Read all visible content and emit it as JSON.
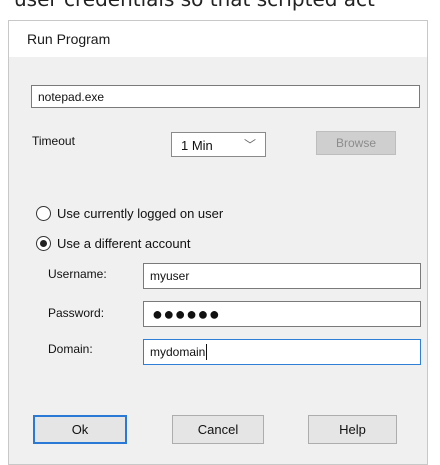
{
  "page_fragment": "user credentials so that scripted act",
  "dialog": {
    "title": "Run Program",
    "program_value": "notepad.exe",
    "timeout_label": "Timeout",
    "timeout_value": "1 Min",
    "browse_label": "Browse",
    "radio_current_label": "Use currently logged on user",
    "radio_different_label": "Use a different account",
    "selected_radio": "different",
    "username_label": "Username:",
    "username_value": "myuser",
    "password_label": "Password:",
    "password_mask": "●●●●●●",
    "domain_label": "Domain:",
    "domain_value": "mydomain",
    "buttons": {
      "ok": "Ok",
      "cancel": "Cancel",
      "help": "Help"
    }
  },
  "icons": {
    "combo_arrow": "chevron-down-icon"
  }
}
